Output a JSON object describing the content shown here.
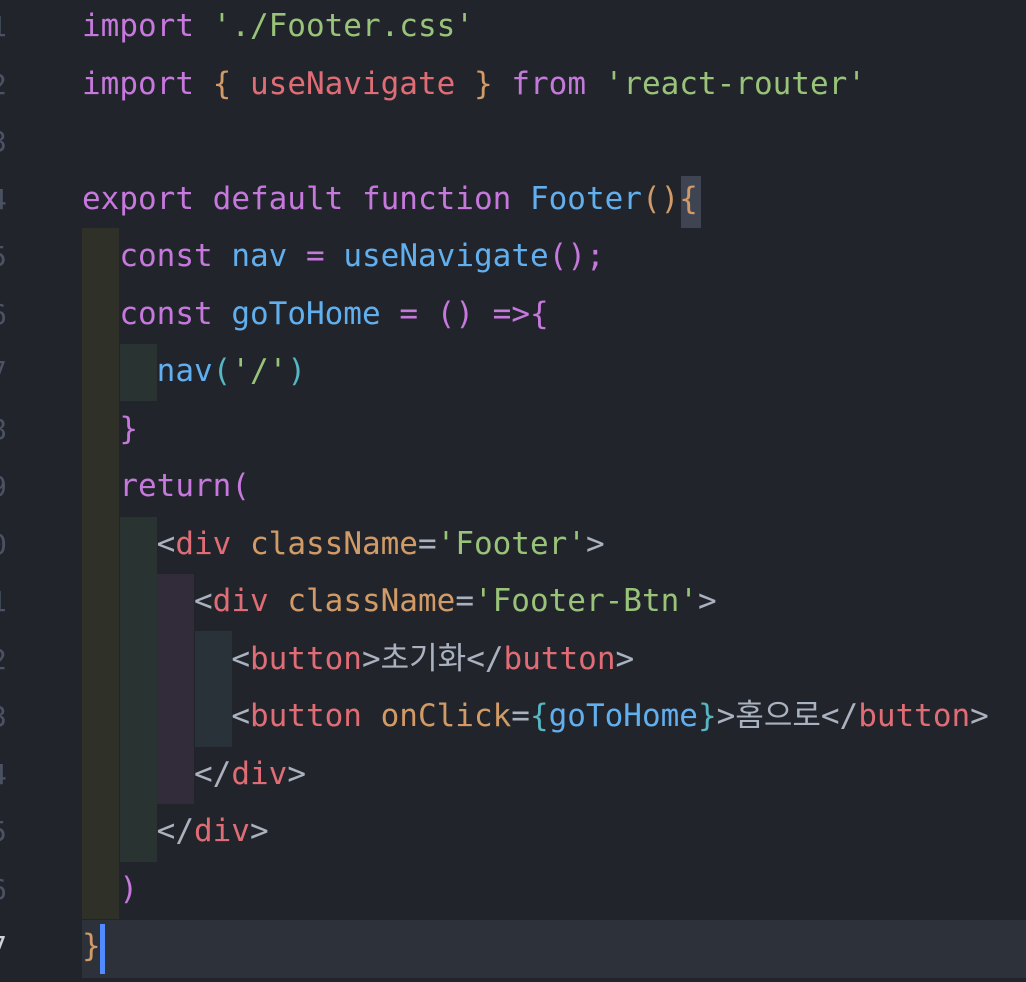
{
  "editor": {
    "line_numbers": [
      "1",
      "2",
      "3",
      "4",
      "5",
      "6",
      "7",
      "8",
      "9",
      "0",
      "1",
      "2",
      "3",
      "4",
      "5",
      "6",
      "7"
    ],
    "current_line_index": 16,
    "colors": {
      "background": "#21252b",
      "keyword": "#c678dd",
      "string": "#98c379",
      "function": "#61afef",
      "variable": "#e06c75",
      "attribute": "#d19a66",
      "bracket_yellow": "#e5c07b",
      "bracket_blue": "#56b6c2",
      "plain": "#abb2bf",
      "current_line": "#2c313a",
      "cursor": "#528bff"
    },
    "lines": [
      [
        {
          "t": "import",
          "c": "#c678dd"
        },
        {
          "t": " ",
          "c": "#abb2bf"
        },
        {
          "t": "'./Footer.css'",
          "c": "#98c379"
        }
      ],
      [
        {
          "t": "import",
          "c": "#c678dd"
        },
        {
          "t": " ",
          "c": "#abb2bf"
        },
        {
          "t": "{",
          "c": "#d19a66"
        },
        {
          "t": " ",
          "c": "#abb2bf"
        },
        {
          "t": "useNavigate",
          "c": "#e06c75"
        },
        {
          "t": " ",
          "c": "#abb2bf"
        },
        {
          "t": "}",
          "c": "#d19a66"
        },
        {
          "t": " ",
          "c": "#abb2bf"
        },
        {
          "t": "from",
          "c": "#c678dd"
        },
        {
          "t": " ",
          "c": "#abb2bf"
        },
        {
          "t": "'react-router'",
          "c": "#98c379"
        }
      ],
      [],
      [
        {
          "t": "export",
          "c": "#c678dd"
        },
        {
          "t": " ",
          "c": "#abb2bf"
        },
        {
          "t": "default",
          "c": "#c678dd"
        },
        {
          "t": " ",
          "c": "#abb2bf"
        },
        {
          "t": "function",
          "c": "#c678dd"
        },
        {
          "t": " ",
          "c": "#abb2bf"
        },
        {
          "t": "Footer",
          "c": "#61afef"
        },
        {
          "t": "()",
          "c": "#d19a66"
        },
        {
          "t": "{",
          "c": "#d19a66"
        }
      ],
      [
        {
          "t": "  ",
          "c": "#abb2bf"
        },
        {
          "t": "const",
          "c": "#c678dd"
        },
        {
          "t": " ",
          "c": "#abb2bf"
        },
        {
          "t": "nav",
          "c": "#61afef"
        },
        {
          "t": " ",
          "c": "#abb2bf"
        },
        {
          "t": "=",
          "c": "#c678dd"
        },
        {
          "t": " ",
          "c": "#abb2bf"
        },
        {
          "t": "useNavigate",
          "c": "#61afef"
        },
        {
          "t": "();",
          "c": "#c678dd"
        }
      ],
      [
        {
          "t": "  ",
          "c": "#abb2bf"
        },
        {
          "t": "const",
          "c": "#c678dd"
        },
        {
          "t": " ",
          "c": "#abb2bf"
        },
        {
          "t": "goToHome",
          "c": "#61afef"
        },
        {
          "t": " ",
          "c": "#abb2bf"
        },
        {
          "t": "=",
          "c": "#c678dd"
        },
        {
          "t": " ",
          "c": "#abb2bf"
        },
        {
          "t": "()",
          "c": "#c678dd"
        },
        {
          "t": " ",
          "c": "#abb2bf"
        },
        {
          "t": "=>",
          "c": "#c678dd"
        },
        {
          "t": "{",
          "c": "#c678dd"
        }
      ],
      [
        {
          "t": "    ",
          "c": "#abb2bf"
        },
        {
          "t": "nav",
          "c": "#61afef"
        },
        {
          "t": "(",
          "c": "#56b6c2"
        },
        {
          "t": "'/'",
          "c": "#98c379"
        },
        {
          "t": ")",
          "c": "#56b6c2"
        }
      ],
      [
        {
          "t": "  ",
          "c": "#abb2bf"
        },
        {
          "t": "}",
          "c": "#c678dd"
        }
      ],
      [
        {
          "t": "  ",
          "c": "#abb2bf"
        },
        {
          "t": "return",
          "c": "#c678dd"
        },
        {
          "t": "(",
          "c": "#c678dd"
        }
      ],
      [
        {
          "t": "    ",
          "c": "#abb2bf"
        },
        {
          "t": "<",
          "c": "#abb2bf"
        },
        {
          "t": "div",
          "c": "#e06c75"
        },
        {
          "t": " ",
          "c": "#abb2bf"
        },
        {
          "t": "className",
          "c": "#d19a66"
        },
        {
          "t": "=",
          "c": "#abb2bf"
        },
        {
          "t": "'Footer'",
          "c": "#98c379"
        },
        {
          "t": ">",
          "c": "#abb2bf"
        }
      ],
      [
        {
          "t": "      ",
          "c": "#abb2bf"
        },
        {
          "t": "<",
          "c": "#abb2bf"
        },
        {
          "t": "div",
          "c": "#e06c75"
        },
        {
          "t": " ",
          "c": "#abb2bf"
        },
        {
          "t": "className",
          "c": "#d19a66"
        },
        {
          "t": "=",
          "c": "#abb2bf"
        },
        {
          "t": "'Footer-Btn'",
          "c": "#98c379"
        },
        {
          "t": ">",
          "c": "#abb2bf"
        }
      ],
      [
        {
          "t": "        ",
          "c": "#abb2bf"
        },
        {
          "t": "<",
          "c": "#abb2bf"
        },
        {
          "t": "button",
          "c": "#e06c75"
        },
        {
          "t": ">",
          "c": "#abb2bf"
        },
        {
          "t": "초기화",
          "c": "#abb2bf"
        },
        {
          "t": "</",
          "c": "#abb2bf"
        },
        {
          "t": "button",
          "c": "#e06c75"
        },
        {
          "t": ">",
          "c": "#abb2bf"
        }
      ],
      [
        {
          "t": "        ",
          "c": "#abb2bf"
        },
        {
          "t": "<",
          "c": "#abb2bf"
        },
        {
          "t": "button",
          "c": "#e06c75"
        },
        {
          "t": " ",
          "c": "#abb2bf"
        },
        {
          "t": "onClick",
          "c": "#d19a66"
        },
        {
          "t": "=",
          "c": "#abb2bf"
        },
        {
          "t": "{",
          "c": "#56b6c2"
        },
        {
          "t": "goToHome",
          "c": "#61afef"
        },
        {
          "t": "}",
          "c": "#56b6c2"
        },
        {
          "t": ">",
          "c": "#abb2bf"
        },
        {
          "t": "홈으로",
          "c": "#abb2bf"
        },
        {
          "t": "</",
          "c": "#abb2bf"
        },
        {
          "t": "button",
          "c": "#e06c75"
        },
        {
          "t": ">",
          "c": "#abb2bf"
        }
      ],
      [
        {
          "t": "      ",
          "c": "#abb2bf"
        },
        {
          "t": "</",
          "c": "#abb2bf"
        },
        {
          "t": "div",
          "c": "#e06c75"
        },
        {
          "t": ">",
          "c": "#abb2bf"
        }
      ],
      [
        {
          "t": "    ",
          "c": "#abb2bf"
        },
        {
          "t": "</",
          "c": "#abb2bf"
        },
        {
          "t": "div",
          "c": "#e06c75"
        },
        {
          "t": ">",
          "c": "#abb2bf"
        }
      ],
      [
        {
          "t": "  ",
          "c": "#abb2bf"
        },
        {
          "t": ")",
          "c": "#c678dd"
        }
      ],
      [
        {
          "t": "}",
          "c": "#d19a66"
        }
      ]
    ]
  }
}
